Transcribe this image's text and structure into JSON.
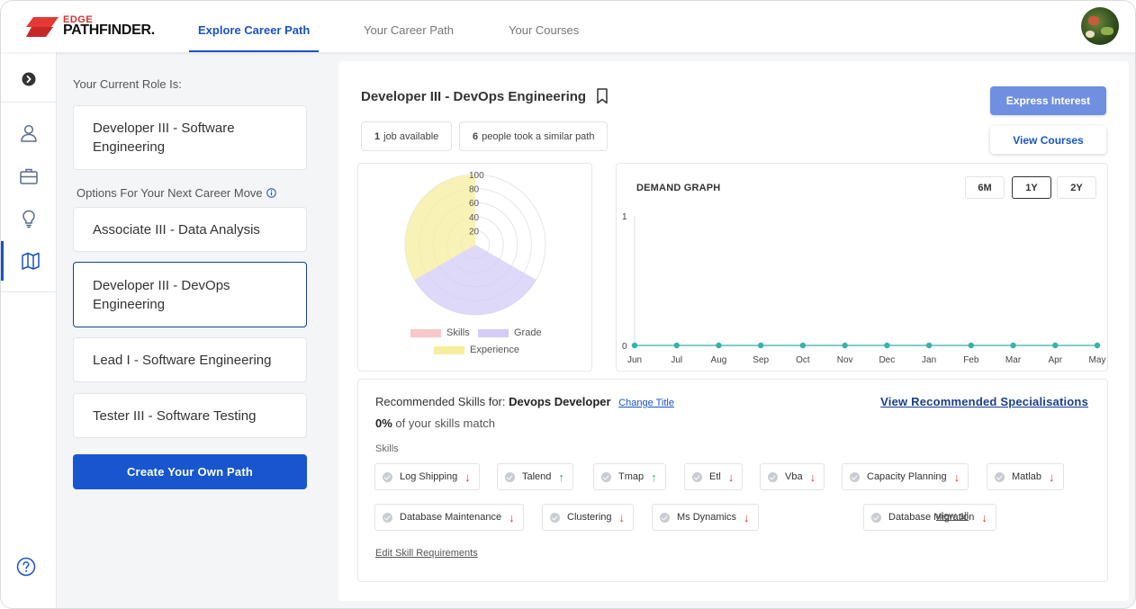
{
  "header": {
    "logo_top": "EDGE",
    "logo_bottom": "PATHFINDER.",
    "tabs": [
      {
        "label": "Explore Career Path",
        "active": true
      },
      {
        "label": "Your Career Path",
        "active": false
      },
      {
        "label": "Your Courses",
        "active": false
      }
    ],
    "accent_color": "#1a53c4"
  },
  "rail": {
    "icons": [
      "chevron-right-circle-icon",
      "user-icon",
      "briefcase-icon",
      "lightbulb-icon",
      "map-icon",
      "help-icon"
    ],
    "active": "map-icon"
  },
  "left": {
    "current_role_label": "Your Current Role Is:",
    "current_role": "Developer III - Software Engineering",
    "options_label": "Options For Your Next Career Move",
    "options": [
      {
        "label": "Associate III - Data Analysis",
        "selected": false
      },
      {
        "label": "Developer III - DevOps Engineering",
        "selected": true
      },
      {
        "label": "Lead I - Software Engineering",
        "selected": false
      },
      {
        "label": "Tester III - Software Testing",
        "selected": false
      }
    ],
    "create_button": "Create Your Own Path"
  },
  "main": {
    "title": "Developer III - DevOps Engineering",
    "jobs_count": "1",
    "jobs_text": "job available",
    "people_count": "6",
    "people_text": "people took a similar path",
    "express_interest": "Express Interest",
    "view_courses": "View Courses"
  },
  "radar": {
    "ticks": [
      "100",
      "80",
      "60",
      "40",
      "20"
    ],
    "legend": [
      {
        "name": "Skills",
        "color": "#f8c7c7"
      },
      {
        "name": "Grade",
        "color": "#d4ccf7"
      },
      {
        "name": "Experience",
        "color": "#f7ee9e"
      }
    ]
  },
  "demand": {
    "title": "DEMAND GRAPH",
    "ranges": [
      {
        "label": "6M",
        "active": false
      },
      {
        "label": "1Y",
        "active": true
      },
      {
        "label": "2Y",
        "active": false
      }
    ],
    "line_color": "#35b3a8"
  },
  "chart_data": [
    {
      "type": "line",
      "title": "DEMAND GRAPH",
      "x": [
        "Jun",
        "Jul",
        "Aug",
        "Sep",
        "Oct",
        "Nov",
        "Dec",
        "Jan",
        "Feb",
        "Mar",
        "Apr",
        "May"
      ],
      "series": [
        {
          "values": [
            0,
            0,
            0,
            0,
            0,
            0,
            0,
            0,
            0,
            0,
            0,
            0
          ]
        }
      ],
      "y_ticks": [
        "1",
        "0"
      ],
      "ylim": [
        0,
        1
      ],
      "grid": false
    },
    {
      "type": "radar",
      "categories": [
        "Skills",
        "Grade",
        "Experience"
      ],
      "series": [
        {
          "name": "Skills",
          "values": [
            0
          ]
        },
        {
          "name": "Grade",
          "values": [
            100
          ]
        },
        {
          "name": "Experience",
          "values": [
            100
          ]
        }
      ],
      "ticks": [
        20,
        40,
        60,
        80,
        100
      ],
      "rlim": [
        0,
        100
      ]
    }
  ],
  "skills": {
    "rec_prefix": "Recommended Skills for:",
    "rec_role": "Devops Developer",
    "change_title": "Change Title",
    "view_specialisations": "View Recommended Specialisations",
    "match_pct": "0%",
    "match_text": "of your skills match",
    "section_label": "Skills",
    "chips": [
      {
        "label": "Log Shipping",
        "trend": "down"
      },
      {
        "label": "Talend",
        "trend": "up"
      },
      {
        "label": "Tmap",
        "trend": "up"
      },
      {
        "label": "Etl",
        "trend": "down"
      },
      {
        "label": "Vba",
        "trend": "down"
      },
      {
        "label": "Capacity Planning",
        "trend": "down"
      },
      {
        "label": "Matlab",
        "trend": "down"
      },
      {
        "label": "Database Maintenance",
        "trend": "down"
      },
      {
        "label": "Clustering",
        "trend": "down"
      },
      {
        "label": "Ms Dynamics",
        "trend": "down"
      },
      {
        "label": "Database Migration",
        "trend": "down"
      }
    ],
    "view_all": "view all",
    "edit_requirements": "Edit Skill Requirements"
  }
}
